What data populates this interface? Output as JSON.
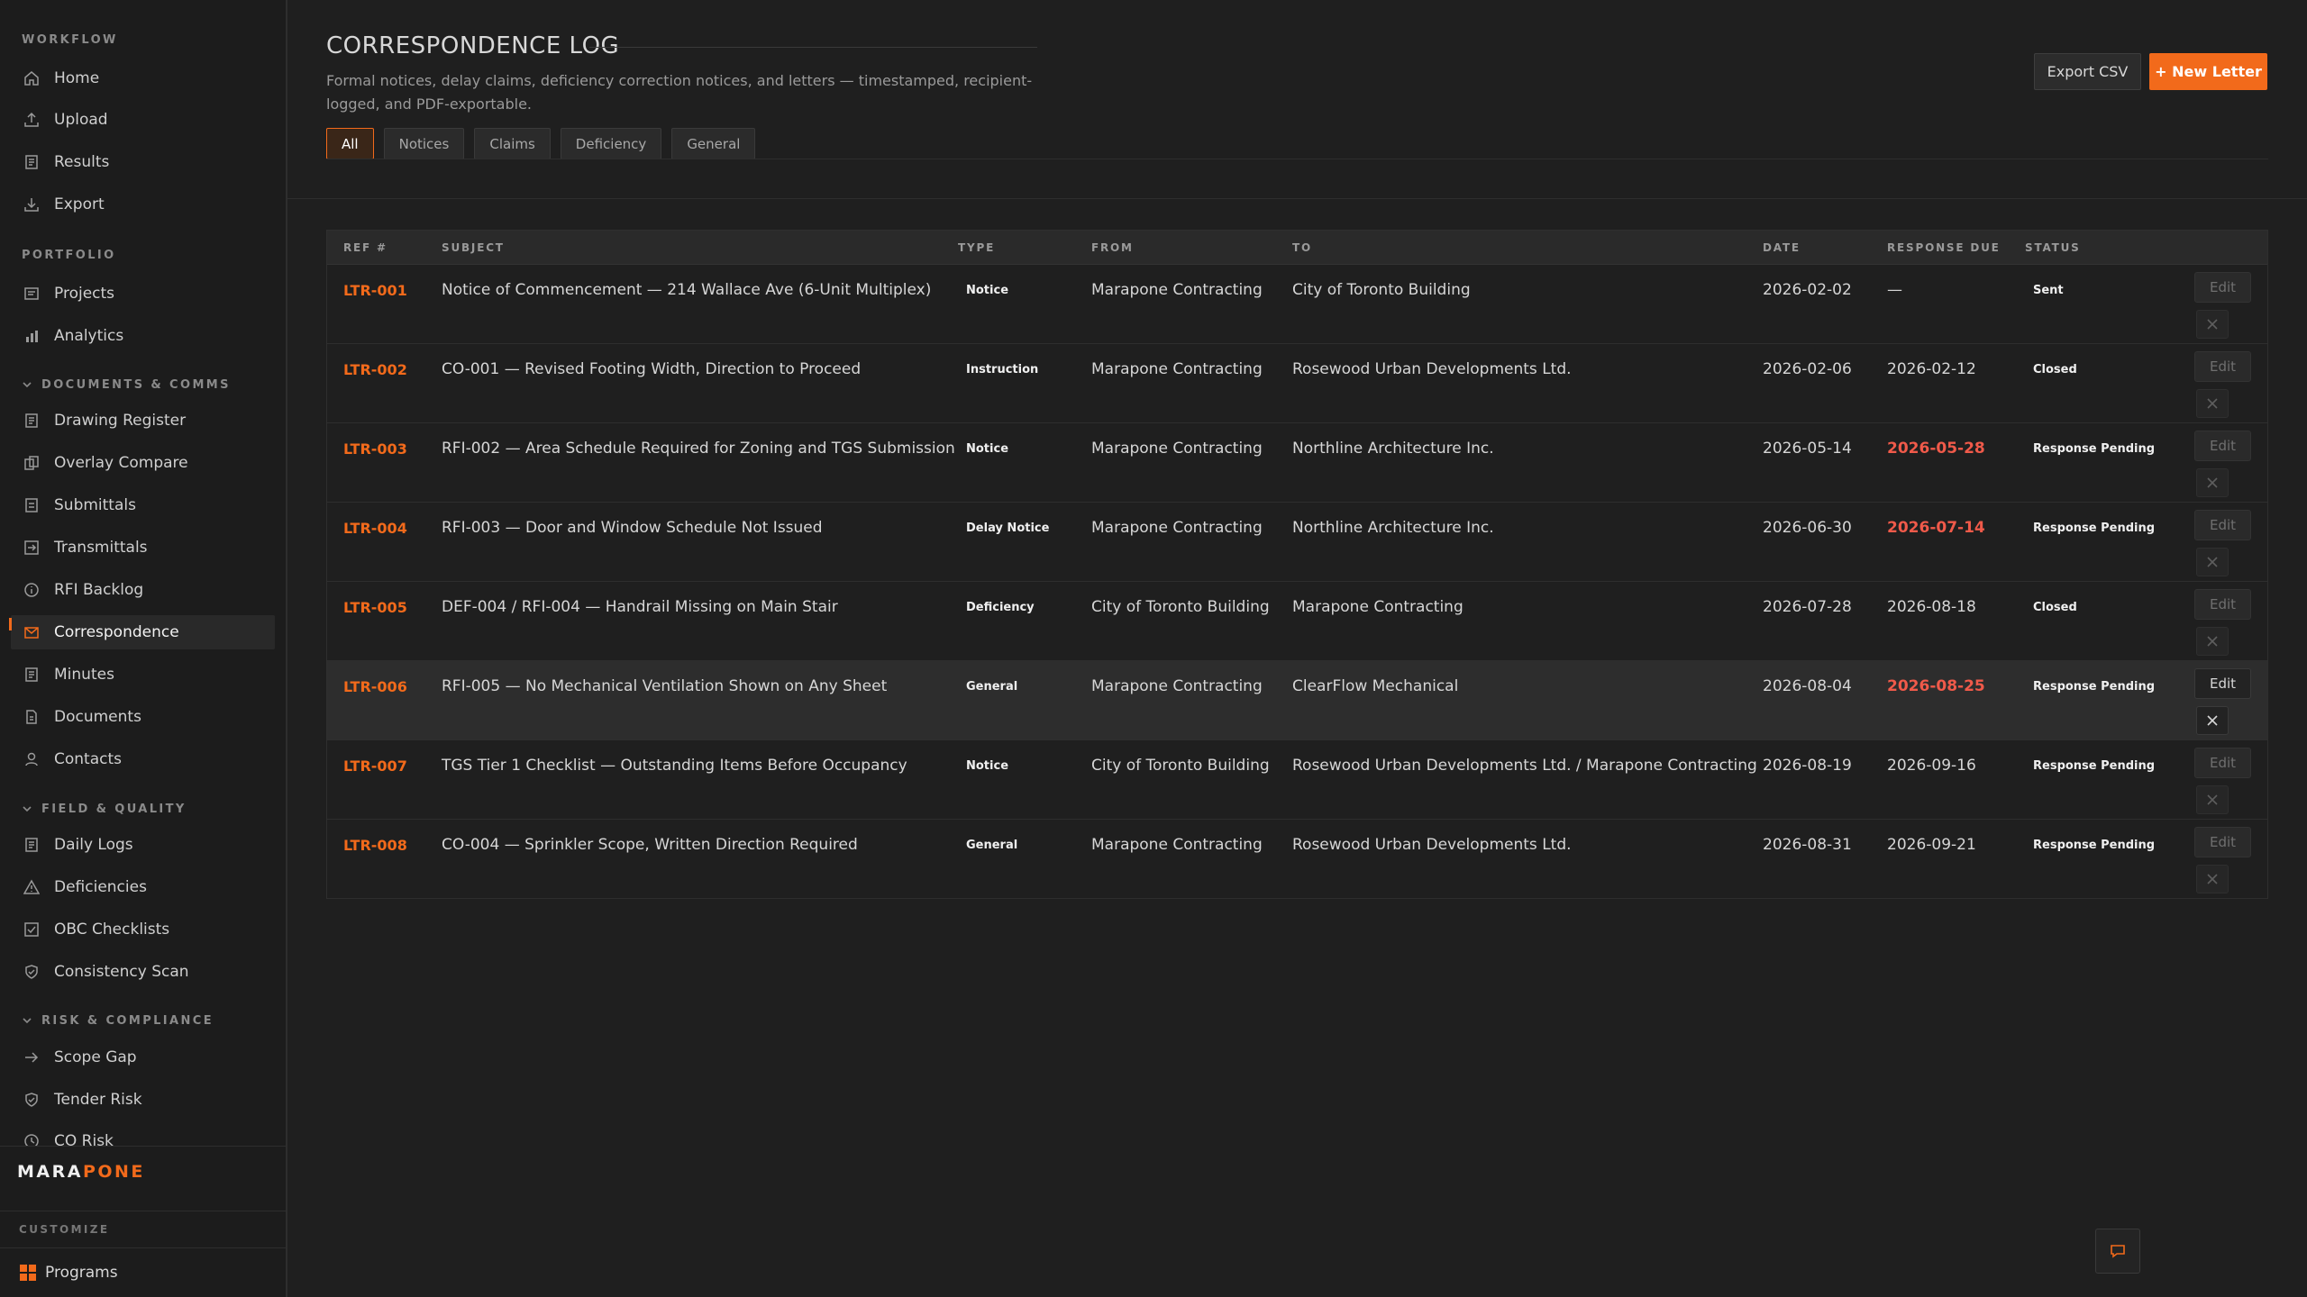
{
  "sidebar": {
    "sections": [
      {
        "label": "WORKFLOW",
        "items": [
          "Home",
          "Upload",
          "Results",
          "Export"
        ]
      },
      {
        "label": "PORTFOLIO",
        "items": [
          "Projects",
          "Analytics"
        ]
      },
      {
        "label": "DOCUMENTS & COMMS",
        "items": [
          "Drawing Register",
          "Overlay Compare",
          "Submittals",
          "Transmittals",
          "RFI Backlog",
          "Correspondence",
          "Minutes",
          "Documents",
          "Contacts"
        ]
      },
      {
        "label": "FIELD & QUALITY",
        "items": [
          "Daily Logs",
          "Deficiencies",
          "OBC Checklists",
          "Consistency Scan"
        ]
      },
      {
        "label": "RISK & COMPLIANCE",
        "items": [
          "Scope Gap",
          "Tender Risk",
          "CO Risk"
        ]
      }
    ],
    "active_item": "Correspondence",
    "brand_a": "MARA",
    "brand_b": "PONE",
    "customize_label": "CUSTOMIZE",
    "programs_label": "Programs"
  },
  "header": {
    "title": "CORRESPONDENCE LOG",
    "subtitle": "Formal notices, delay claims, deficiency correction notices, and letters — timestamped, recipient-logged, and PDF-exportable.",
    "export_label": "Export CSV",
    "new_label": "+ New Letter"
  },
  "filters": [
    "All",
    "Notices",
    "Claims",
    "Deficiency",
    "General"
  ],
  "active_filter": "All",
  "table": {
    "columns": [
      "REF #",
      "SUBJECT",
      "TYPE",
      "FROM",
      "TO",
      "DATE",
      "RESPONSE DUE",
      "STATUS"
    ],
    "edit_label": "Edit",
    "rows": [
      {
        "ref": "LTR-001",
        "subject": "Notice of Commencement — 214 Wallace Ave (6-Unit Multiplex)",
        "type": "Notice",
        "from": "Marapone Contracting",
        "to": "City of Toronto Building",
        "date": "2026-02-02",
        "due": "—",
        "overdue": false,
        "status": "Sent"
      },
      {
        "ref": "LTR-002",
        "subject": "CO-001 — Revised Footing Width, Direction to Proceed",
        "type": "Instruction",
        "from": "Marapone Contracting",
        "to": "Rosewood Urban Developments Ltd.",
        "date": "2026-02-06",
        "due": "2026-02-12",
        "overdue": false,
        "status": "Closed"
      },
      {
        "ref": "LTR-003",
        "subject": "RFI-002 — Area Schedule Required for Zoning and TGS Submission",
        "type": "Notice",
        "from": "Marapone Contracting",
        "to": "Northline Architecture Inc.",
        "date": "2026-05-14",
        "due": "2026-05-28",
        "overdue": true,
        "status": "Response Pending"
      },
      {
        "ref": "LTR-004",
        "subject": "RFI-003 — Door and Window Schedule Not Issued",
        "type": "Delay Notice",
        "from": "Marapone Contracting",
        "to": "Northline Architecture Inc.",
        "date": "2026-06-30",
        "due": "2026-07-14",
        "overdue": true,
        "status": "Response Pending"
      },
      {
        "ref": "LTR-005",
        "subject": "DEF-004 / RFI-004 — Handrail Missing on Main Stair",
        "type": "Deficiency",
        "from": "City of Toronto Building",
        "to": "Marapone Contracting",
        "date": "2026-07-28",
        "due": "2026-08-18",
        "overdue": false,
        "status": "Closed"
      },
      {
        "ref": "LTR-006",
        "subject": "RFI-005 — No Mechanical Ventilation Shown on Any Sheet",
        "type": "General",
        "from": "Marapone Contracting",
        "to": "ClearFlow Mechanical",
        "date": "2026-08-04",
        "due": "2026-08-25",
        "overdue": true,
        "status": "Response Pending",
        "highlighted": true
      },
      {
        "ref": "LTR-007",
        "subject": "TGS Tier 1 Checklist — Outstanding Items Before Occupancy",
        "type": "Notice",
        "from": "City of Toronto Building",
        "to": "Rosewood Urban Developments Ltd. / Marapone Contracting",
        "date": "2026-08-19",
        "due": "2026-09-16",
        "overdue": false,
        "status": "Response Pending"
      },
      {
        "ref": "LTR-008",
        "subject": "CO-004 — Sprinkler Scope, Written Direction Required",
        "type": "General",
        "from": "Marapone Contracting",
        "to": "Rosewood Urban Developments Ltd.",
        "date": "2026-08-31",
        "due": "2026-09-21",
        "overdue": false,
        "status": "Response Pending"
      }
    ]
  },
  "colors": {
    "accent": "#f26a1b",
    "overdue": "#f05a4a",
    "background": "#1f1f1f"
  }
}
